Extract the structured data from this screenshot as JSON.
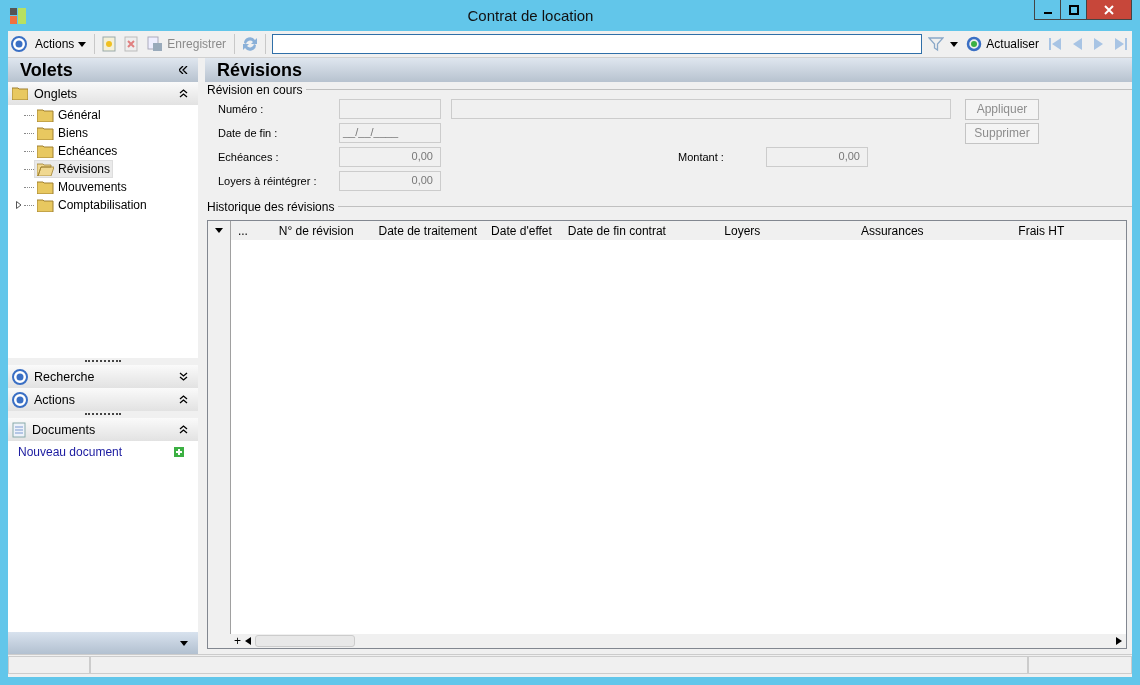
{
  "window": {
    "title": "Contrat de location"
  },
  "toolbar": {
    "actions_label": "Actions",
    "save_label": "Enregistrer",
    "refresh_label": "Actualiser"
  },
  "panes": {
    "title": "Volets",
    "tabs_section": {
      "title": "Onglets",
      "expanded": true,
      "items": [
        {
          "label": "Général",
          "selected": false,
          "expandable": false
        },
        {
          "label": "Biens",
          "selected": false,
          "expandable": false
        },
        {
          "label": "Echéances",
          "selected": false,
          "expandable": false
        },
        {
          "label": "Révisions",
          "selected": true,
          "expandable": false
        },
        {
          "label": "Mouvements",
          "selected": false,
          "expandable": false
        },
        {
          "label": "Comptabilisation",
          "selected": false,
          "expandable": true
        }
      ]
    },
    "sections": [
      {
        "title": "Recherche",
        "kind": "target",
        "expanded": false
      },
      {
        "title": "Actions",
        "kind": "target",
        "expanded": true
      },
      {
        "title": "Documents",
        "kind": "document",
        "expanded": true,
        "links": [
          {
            "label": "Nouveau document"
          }
        ]
      }
    ]
  },
  "main": {
    "title": "Révisions",
    "current": {
      "title": "Révision en cours",
      "numero_label": "Numéro :",
      "date_label": "Date de fin :",
      "date_value": "__/__/____",
      "echeances_label": "Echéances :",
      "echeances_value": "0,00",
      "loyers_label": "Loyers à réintégrer :",
      "loyers_value": "0,00",
      "montant_label": "Montant :",
      "montant_value": "0,00",
      "buttons": [
        {
          "label": "Appliquer",
          "disabled": true
        },
        {
          "label": "Supprimer",
          "disabled": true
        }
      ]
    },
    "history": {
      "title": "Historique des révisions",
      "columns": [
        "...",
        "N° de révision",
        "Date de traitement",
        "Date d'effet",
        "Date de fin contrat",
        "Loyers",
        "Assurances",
        "Frais HT"
      ],
      "add_label": "+"
    }
  }
}
